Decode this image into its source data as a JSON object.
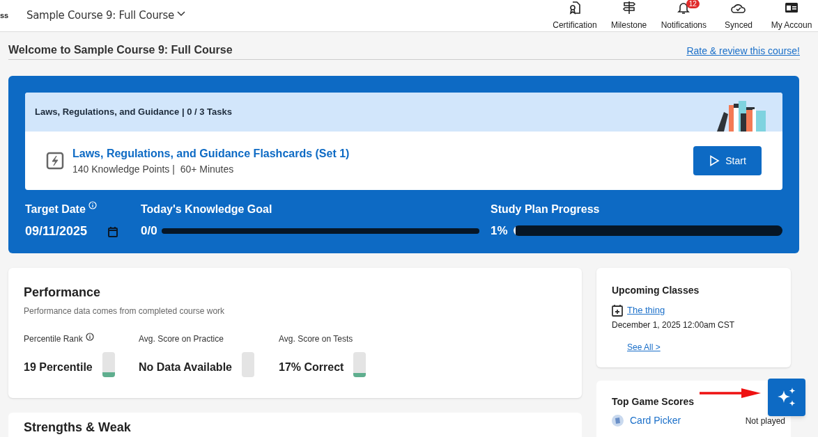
{
  "header": {
    "logo_text": "ss",
    "course_selector": "Sample Course 9: Full Course",
    "nav": [
      {
        "kind": "certification",
        "label": "Certification"
      },
      {
        "kind": "milestone",
        "label": "Milestone"
      },
      {
        "kind": "notifications",
        "label": "Notifications",
        "badge": "12"
      },
      {
        "kind": "synced",
        "label": "Synced"
      },
      {
        "kind": "account",
        "label": "My Accoun"
      }
    ]
  },
  "welcome": {
    "title": "Welcome to Sample Course 9: Full Course",
    "review_link": "Rate & review this course!"
  },
  "study_plan": {
    "section": "Laws, Regulations, and Guidance | 0 / 3 Tasks",
    "task": {
      "title": "Laws, Regulations, and Guidance Flashcards (Set 1)",
      "meta": "140 Knowledge Points |  60+ Minutes",
      "button": "Start"
    },
    "target_date": {
      "label": "Target Date",
      "value": "09/11/2025"
    },
    "knowledge_goal": {
      "label": "Today's Knowledge Goal",
      "reading": "0/0",
      "level": 0
    },
    "progress": {
      "label": "Study Plan Progress",
      "reading": "1%",
      "level": 0.01
    }
  },
  "performance": {
    "title": "Performance",
    "subtitle": "Performance data comes from completed course work",
    "metrics": [
      {
        "label": "Percentile Rank",
        "info": true,
        "value": "19 Percentile",
        "level": 0.19
      },
      {
        "label": "Avg. Score on Practice",
        "info": false,
        "value": "No Data Available",
        "level": 0
      },
      {
        "label": "Avg. Score on Tests",
        "info": false,
        "value": "17% Correct",
        "level": 0.17
      }
    ]
  },
  "next_card_title": "Strengths & Weak",
  "upcoming_classes": {
    "title": "Upcoming Classes",
    "event": "The thing",
    "when": "December 1, 2025 12:00am CST",
    "see_all": "See All >"
  },
  "top_game_scores": {
    "title": "Top Game Scores",
    "games": [
      {
        "name": "Card Picker",
        "score": "Not played"
      }
    ]
  }
}
